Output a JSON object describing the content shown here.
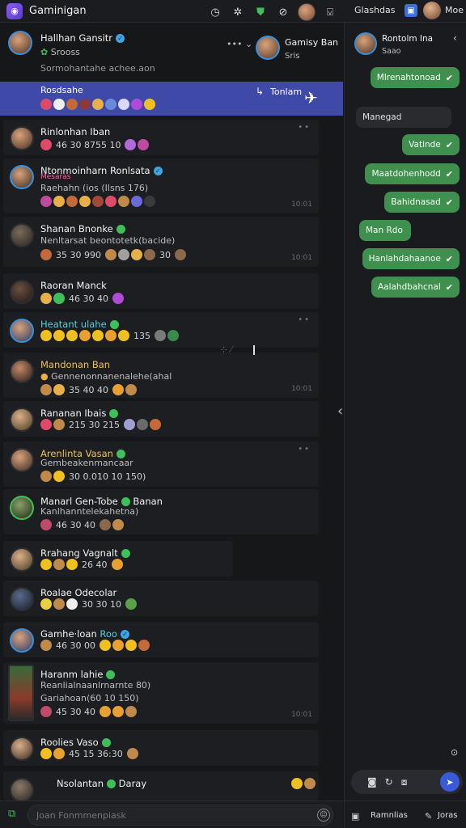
{
  "app": {
    "title": "Gaminigan"
  },
  "topbar": {
    "right_label": "Glashdas",
    "right_name": "Moe"
  },
  "header": {
    "name": "Hallhan Gansitr",
    "sub": "Srooss",
    "status": "Sormohantahe achee.aon",
    "menu": "••• ⌄",
    "second_name": "Gamisy Ban",
    "second_sub": "Sris"
  },
  "pinned": {
    "title": "Rosdsahe",
    "right_label": "Tonlam"
  },
  "chats": [
    {
      "name": "Rinlonhan Iban",
      "name_color": "white",
      "dot": "",
      "sub": "",
      "reacts": "46 30 8755 10",
      "ts": "",
      "more": "••"
    },
    {
      "name": "Ntonmoinharn Ronlsata",
      "name_color": "white",
      "dot": "blue",
      "sub": "Mesaras",
      "sub2": "Raehahn (ios (Ilsns 176)",
      "reacts": "",
      "ts": "10:01",
      "more": ""
    },
    {
      "name": "Shanan Bnonke",
      "name_color": "white",
      "dot": "green",
      "sub": "Nenltarsat beontotetk(bacide)",
      "reacts": "35 30 990",
      "reacts2": "30",
      "ts": "10:01",
      "more": ""
    },
    {
      "name": "Raoran Manck",
      "name_color": "white",
      "dot": "",
      "sub": "",
      "reacts": "46 30 40",
      "ts": "",
      "more": ""
    },
    {
      "name": "Heatant ulahe",
      "name_color": "teal",
      "dot": "green",
      "sub": "",
      "reacts": "135",
      "ts": "",
      "more": "••"
    },
    {
      "name": "Mandonan Ban",
      "name_color": "gold",
      "dot": "",
      "sub": "Gennenonnanenalehe(ahal",
      "reacts": "35 40 40",
      "ts": "10:01",
      "more": ""
    },
    {
      "name": "Rananan Ibais",
      "name_color": "white",
      "dot": "green",
      "sub": "",
      "reacts": "215 30 215",
      "ts": "",
      "more": ""
    },
    {
      "name": "Arenlinta Vasan",
      "name_color": "gold",
      "dot": "green",
      "sub": "Gembeakenmancaar",
      "reacts": "30 0.010 10 150)",
      "ts": "",
      "more": "••"
    },
    {
      "name": "Manarl Gen-Tobe",
      "name_color": "white",
      "dot": "green",
      "name_extra": "Banan",
      "sub": "Kanlhanntelekahetna)",
      "reacts": "46 30 40",
      "ts": "",
      "more": ""
    },
    {
      "name": "Rrahang Vagnalt",
      "name_color": "white",
      "dot": "green",
      "sub": "",
      "reacts": "26 40",
      "ts": "",
      "more": ""
    },
    {
      "name": "Roalae Odecolar",
      "name_color": "white",
      "dot": "",
      "sub": "",
      "reacts": "30 30 10",
      "ts": "",
      "more": ""
    },
    {
      "name": "Gamhe·loan",
      "name_color": "white",
      "dot": "blue",
      "name_extra": "Roo",
      "sub": "",
      "reacts": "46 30 00",
      "ts": "",
      "more": ""
    },
    {
      "name": "Haranm lahie",
      "name_color": "white",
      "dot": "green",
      "sub": "Reanlialnaanlrnarnte 80)",
      "sub2": "Gariahoan(60 10 150)",
      "reacts": "45 30 40",
      "ts": "10:01",
      "more": ""
    },
    {
      "name": "Roolies Vaso",
      "name_color": "white",
      "dot": "green",
      "sub": "",
      "reacts": "45 15 36:30",
      "ts": "",
      "more": ""
    },
    {
      "name": "Nsolantan",
      "name_color": "white",
      "dot": "green",
      "name_extra": "Daray",
      "sub": "",
      "reacts": "",
      "ts": "",
      "more": ""
    }
  ],
  "composer": {
    "placeholder": "Joan Fonmmenpiask"
  },
  "right_panel": {
    "name": "Rontolm Ina",
    "sub": "Saao",
    "messages": [
      {
        "dir": "out",
        "text": "Mlrenahtonoad"
      },
      {
        "dir": "in",
        "text": "Manegad"
      },
      {
        "dir": "out",
        "text": "Vatinde"
      },
      {
        "dir": "out",
        "text": "Maatdohenhodd"
      },
      {
        "dir": "out",
        "text": "Bahidnasad"
      },
      {
        "dir": "in",
        "text": "Man Rdo"
      },
      {
        "dir": "out",
        "text": "Hanlahdahaanoe"
      },
      {
        "dir": "out",
        "text": "Aalahdbahcnal"
      }
    ],
    "bottom_left": "Ramnlias",
    "bottom_right": "Joras"
  },
  "colors": {
    "accent_green": "#3f8f4f",
    "pinned_bar": "#3f4aa8",
    "status_green": "#3fbf5a"
  }
}
